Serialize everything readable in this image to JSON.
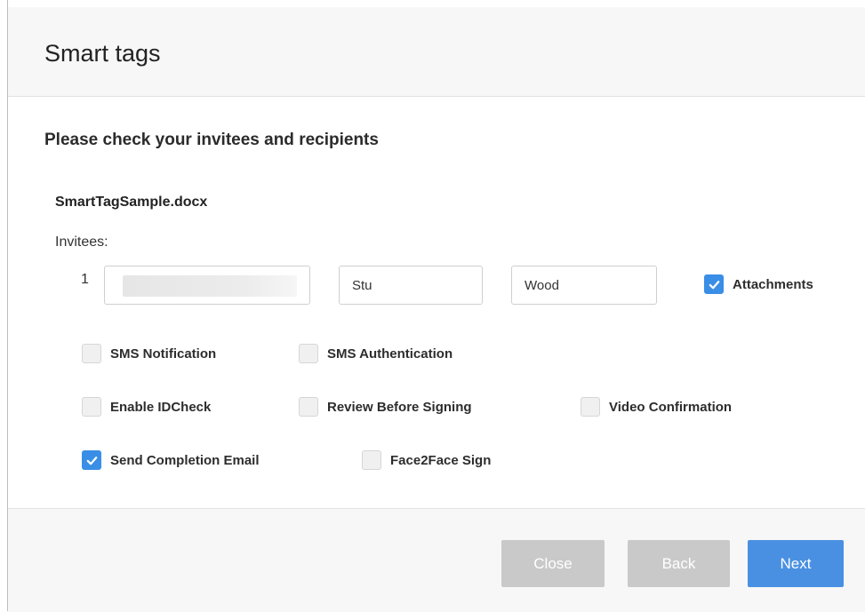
{
  "dialog": {
    "title": "Smart tags",
    "subtitle": "Please check your invitees and recipients"
  },
  "document": {
    "filename": "SmartTagSample.docx"
  },
  "invitees": {
    "label": "Invitees:",
    "rows": [
      {
        "index": "1",
        "email": "",
        "first_name": "Stu",
        "last_name": "Wood",
        "attachments": {
          "label": "Attachments",
          "checked": true
        }
      }
    ]
  },
  "options": {
    "sms_notification": {
      "label": "SMS Notification",
      "checked": false
    },
    "sms_authentication": {
      "label": "SMS Authentication",
      "checked": false
    },
    "enable_idcheck": {
      "label": "Enable IDCheck",
      "checked": false
    },
    "review_before_signing": {
      "label": "Review Before Signing",
      "checked": false
    },
    "video_confirmation": {
      "label": "Video Confirmation",
      "checked": false
    },
    "send_completion_email": {
      "label": "Send Completion Email",
      "checked": true
    },
    "face2face_sign": {
      "label": "Face2Face Sign",
      "checked": false
    }
  },
  "footer": {
    "close_label": "Close",
    "back_label": "Back",
    "next_label": "Next"
  },
  "colors": {
    "accent": "#4a90e2",
    "checkbox_checked": "#3a8ee6",
    "button_disabled": "#c9c9c9"
  }
}
